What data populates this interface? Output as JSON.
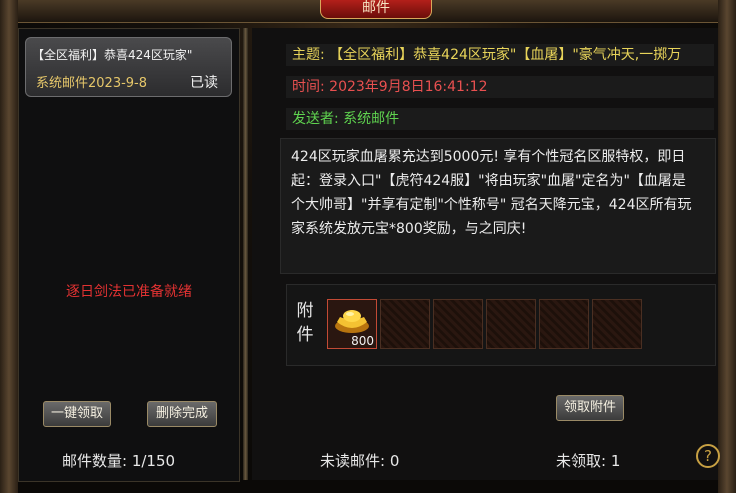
{
  "window": {
    "title": "邮件"
  },
  "mail_list": {
    "items": [
      {
        "title": "【全区福利】恭喜424区玩家\"",
        "date": "系统邮件2023-9-8",
        "status": "已读"
      }
    ],
    "notice": "逐日剑法已准备就绪",
    "claim_all_label": "一键领取",
    "delete_label": "删除完成",
    "count_text": "邮件数量: 1/150"
  },
  "mail_detail": {
    "subject": "主题: 【全区福利】恭喜424区玩家\"【血屠】\"豪气冲天,一掷万",
    "time": "时间: 2023年9月8日16:41:12",
    "sender": "发送者: 系统邮件",
    "body": "424区玩家血屠累充达到5000元! 享有个性冠名区服特权，即日起：登录入口\"【虎符424服】\"将由玩家\"血屠\"定名为\"【血屠是个大帅哥】\"并享有定制\"个性称号\" 冠名天降元宝，424区所有玩家系统发放元宝*800奖励，与之同庆!",
    "attachment_label": "附件",
    "attachments": [
      {
        "icon": "gold-ingot-icon",
        "count": "800"
      }
    ],
    "claim_attach_label": "领取附件"
  },
  "footer": {
    "unread_text": "未读邮件: 0",
    "pending_text": "未领取: 1",
    "help_glyph": "?"
  }
}
